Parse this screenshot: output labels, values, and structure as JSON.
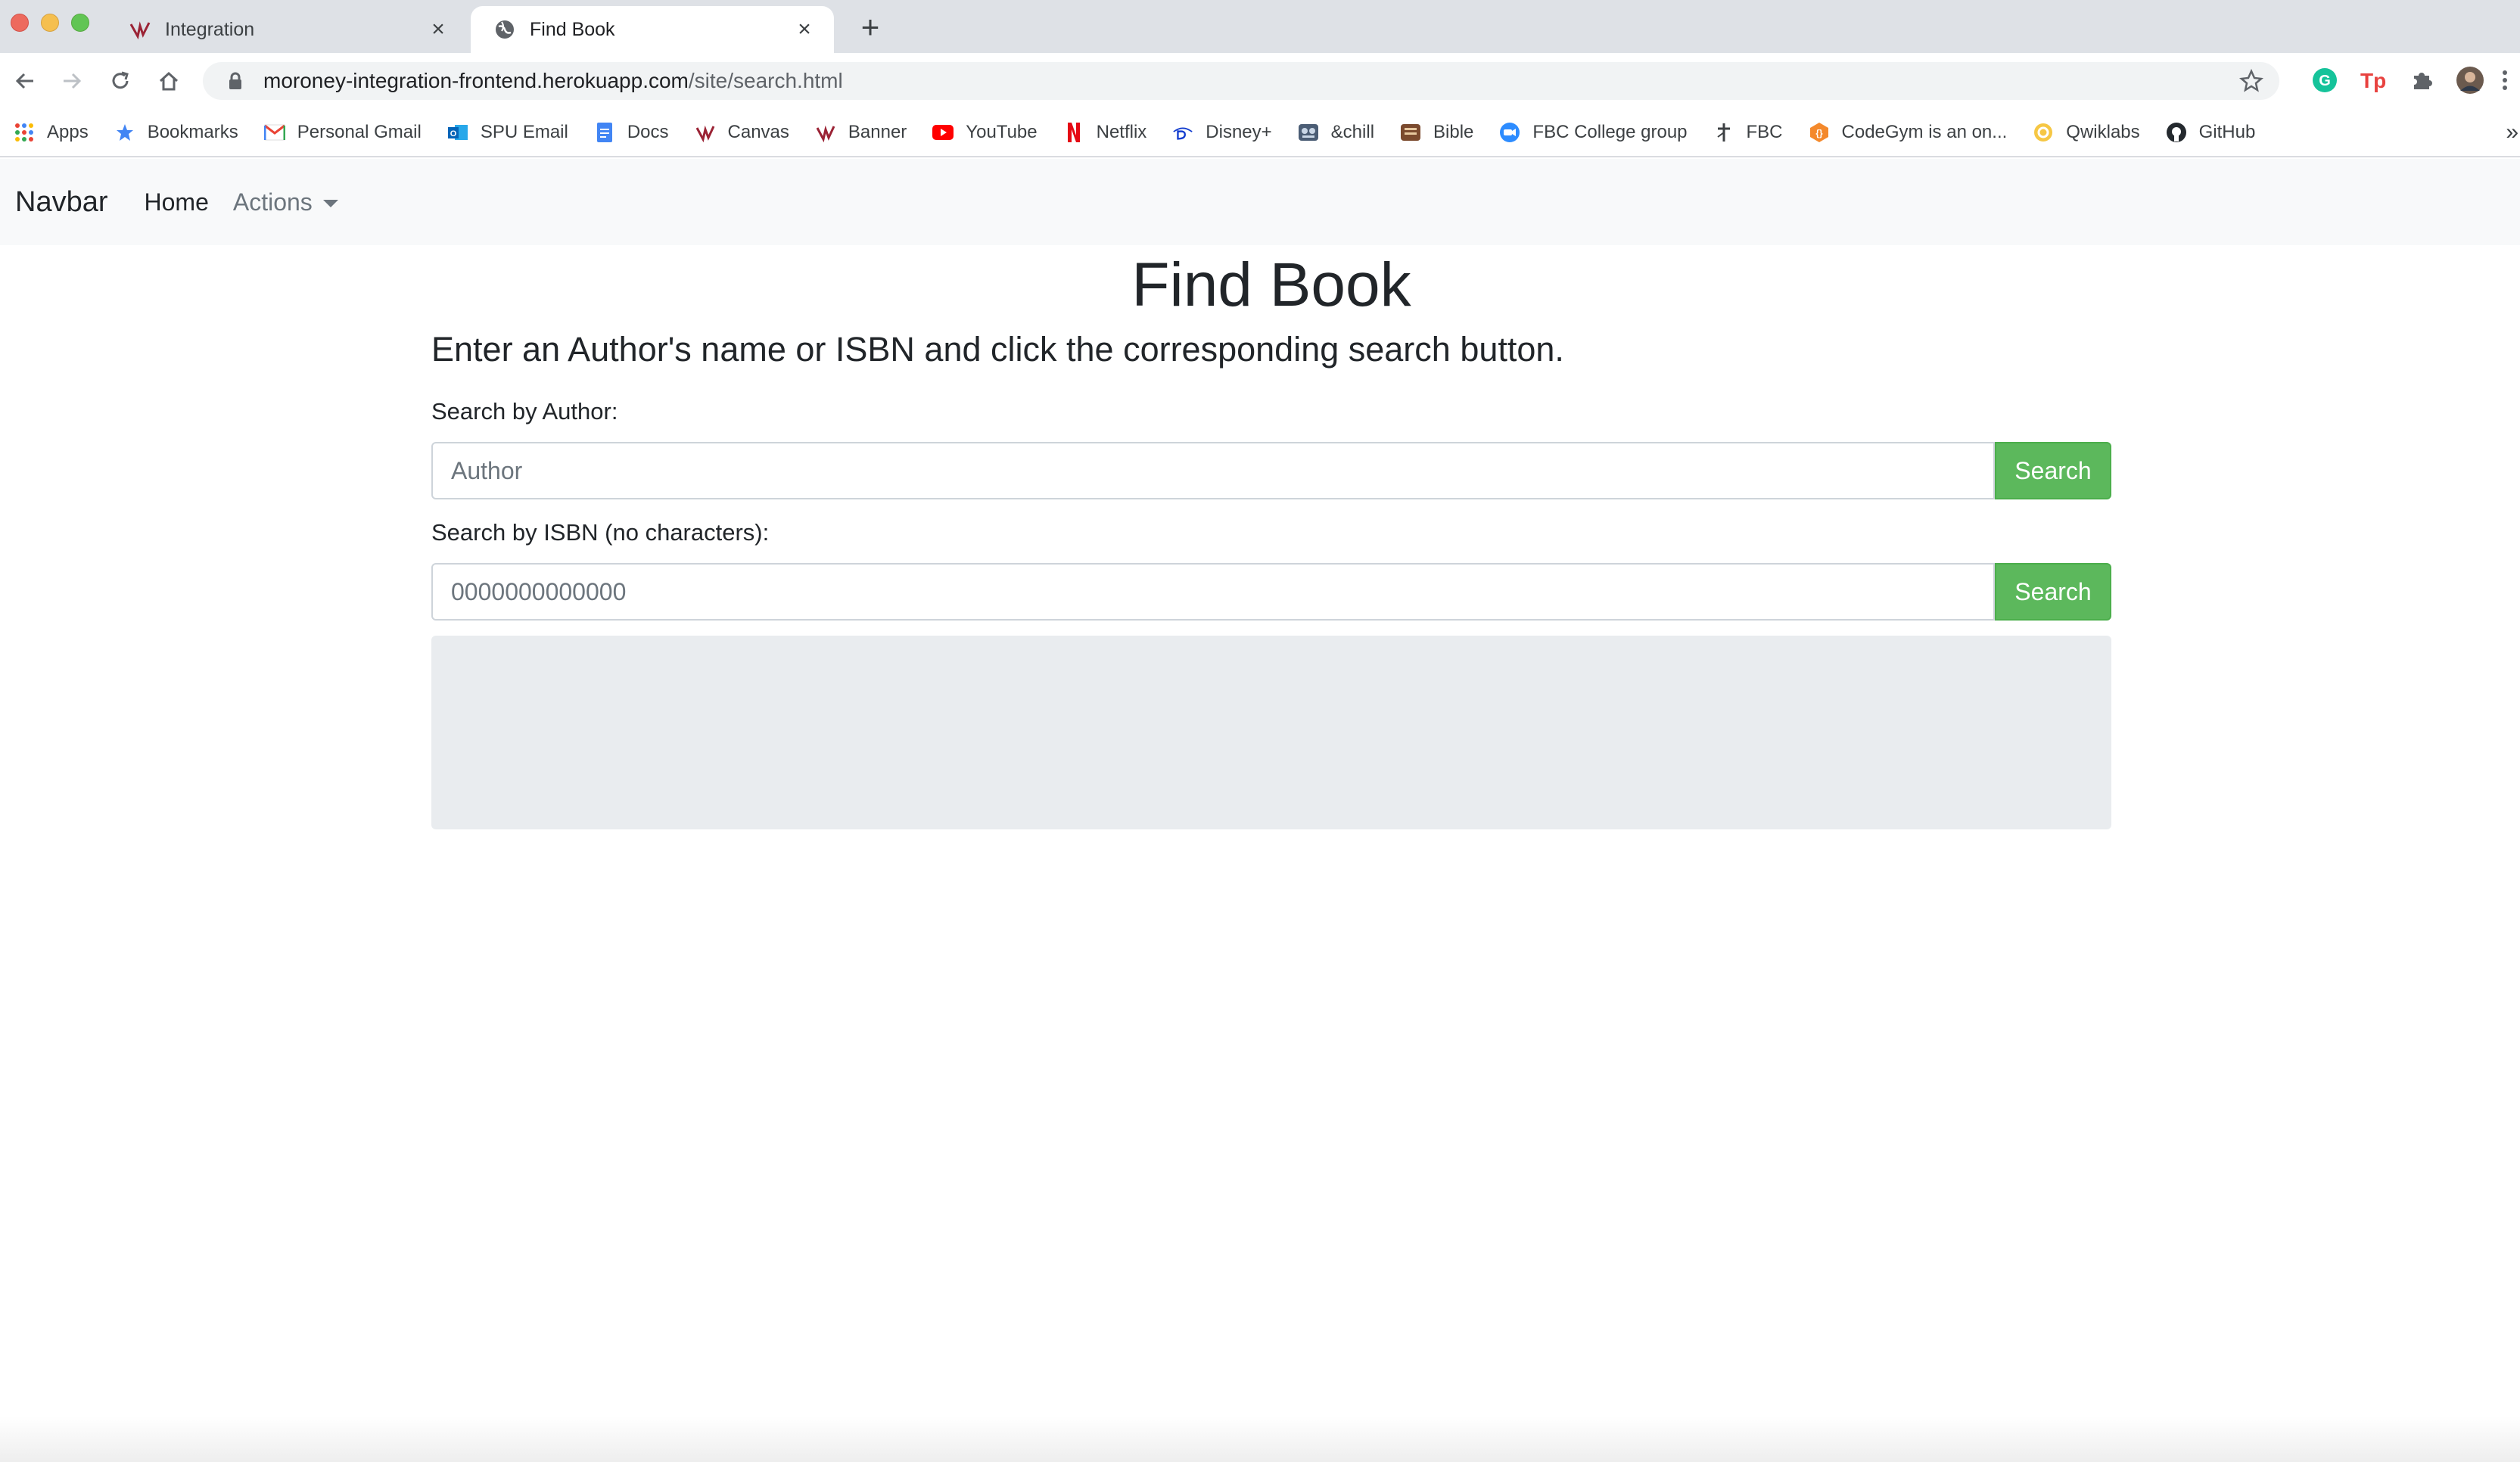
{
  "browser": {
    "tabs": [
      {
        "title": "Integration",
        "active": false
      },
      {
        "title": "Find Book",
        "active": true
      }
    ],
    "address": {
      "host": "moroney-integration-frontend.herokuapp.com",
      "path": "/site/search.html"
    },
    "bookmarks": [
      {
        "label": "Apps",
        "icon": "apps-grid-icon"
      },
      {
        "label": "Bookmarks",
        "icon": "star-icon"
      },
      {
        "label": "Personal Gmail",
        "icon": "gmail-icon"
      },
      {
        "label": "SPU Email",
        "icon": "outlook-icon"
      },
      {
        "label": "Docs",
        "icon": "docs-icon"
      },
      {
        "label": "Canvas",
        "icon": "canvas-icon"
      },
      {
        "label": "Banner",
        "icon": "banner-icon"
      },
      {
        "label": "YouTube",
        "icon": "youtube-icon"
      },
      {
        "label": "Netflix",
        "icon": "netflix-icon"
      },
      {
        "label": "Disney+",
        "icon": "disney-icon"
      },
      {
        "label": "&chill",
        "icon": "chill-icon"
      },
      {
        "label": "Bible",
        "icon": "bible-icon"
      },
      {
        "label": "FBC College group",
        "icon": "zoom-icon"
      },
      {
        "label": "FBC",
        "icon": "fbc-icon"
      },
      {
        "label": "CodeGym is an on...",
        "icon": "codegym-icon"
      },
      {
        "label": "Qwiklabs",
        "icon": "qwiklabs-icon"
      },
      {
        "label": "GitHub",
        "icon": "github-icon"
      }
    ],
    "bookmarks_overflow": "»"
  },
  "navbar": {
    "brand": "Navbar",
    "home": "Home",
    "actions": "Actions"
  },
  "page": {
    "title": "Find Book",
    "instructions": "Enter an Author's name or ISBN and click the corresponding search button.",
    "author_label": "Search by Author:",
    "author_placeholder": "Author",
    "author_button": "Search",
    "isbn_label": "Search by ISBN (no characters):",
    "isbn_placeholder": "0000000000000",
    "isbn_button": "Search"
  },
  "colors": {
    "button_green": "#5cb85c",
    "navbar_bg": "#f8f9fa",
    "results_bg": "#e9ecef"
  }
}
